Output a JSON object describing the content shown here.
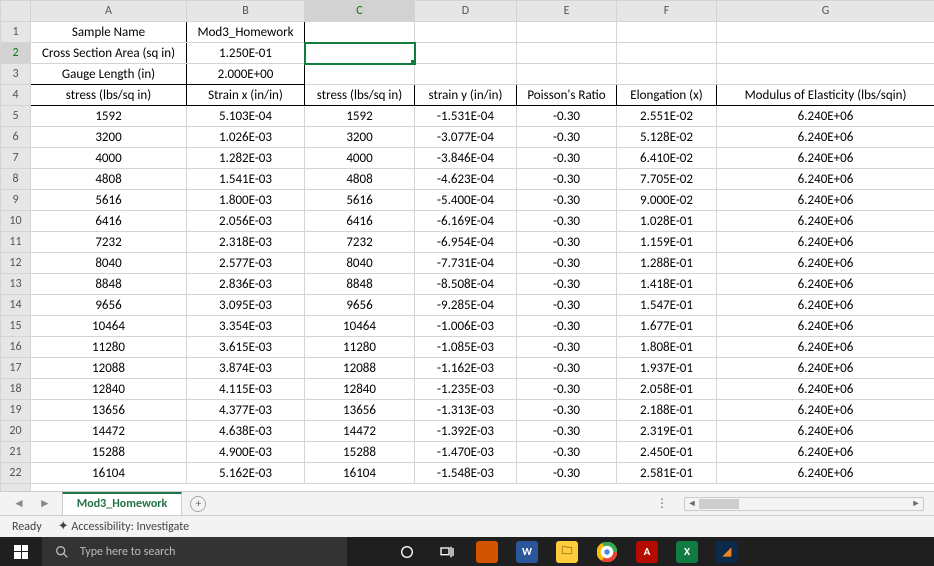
{
  "columns": [
    "A",
    "B",
    "C",
    "D",
    "E",
    "F",
    "G"
  ],
  "rowCount": 23,
  "selectedCell": "C2",
  "header": {
    "r1": {
      "A": "Sample Name",
      "B": "Mod3_Homework"
    },
    "r2": {
      "A": "Cross Section Area (sq in)",
      "B": "1.250E-01"
    },
    "r3": {
      "A": "Gauge Length (in)",
      "B": "2.000E+00"
    },
    "r4": {
      "A": "stress (lbs/sq in)",
      "B": "Strain x (in/in)",
      "C": "stress (lbs/sq in)",
      "D": "strain y (in/in)",
      "E": "Poisson's Ratio",
      "F": "Elongation (x)",
      "G": "Modulus of Elasticity (lbs/sqin)"
    }
  },
  "data": [
    {
      "A": "1592",
      "B": "5.103E-04",
      "C": "1592",
      "D": "-1.531E-04",
      "E": "-0.30",
      "F": "2.551E-02",
      "G": "6.240E+06"
    },
    {
      "A": "3200",
      "B": "1.026E-03",
      "C": "3200",
      "D": "-3.077E-04",
      "E": "-0.30",
      "F": "5.128E-02",
      "G": "6.240E+06"
    },
    {
      "A": "4000",
      "B": "1.282E-03",
      "C": "4000",
      "D": "-3.846E-04",
      "E": "-0.30",
      "F": "6.410E-02",
      "G": "6.240E+06"
    },
    {
      "A": "4808",
      "B": "1.541E-03",
      "C": "4808",
      "D": "-4.623E-04",
      "E": "-0.30",
      "F": "7.705E-02",
      "G": "6.240E+06"
    },
    {
      "A": "5616",
      "B": "1.800E-03",
      "C": "5616",
      "D": "-5.400E-04",
      "E": "-0.30",
      "F": "9.000E-02",
      "G": "6.240E+06"
    },
    {
      "A": "6416",
      "B": "2.056E-03",
      "C": "6416",
      "D": "-6.169E-04",
      "E": "-0.30",
      "F": "1.028E-01",
      "G": "6.240E+06"
    },
    {
      "A": "7232",
      "B": "2.318E-03",
      "C": "7232",
      "D": "-6.954E-04",
      "E": "-0.30",
      "F": "1.159E-01",
      "G": "6.240E+06"
    },
    {
      "A": "8040",
      "B": "2.577E-03",
      "C": "8040",
      "D": "-7.731E-04",
      "E": "-0.30",
      "F": "1.288E-01",
      "G": "6.240E+06"
    },
    {
      "A": "8848",
      "B": "2.836E-03",
      "C": "8848",
      "D": "-8.508E-04",
      "E": "-0.30",
      "F": "1.418E-01",
      "G": "6.240E+06"
    },
    {
      "A": "9656",
      "B": "3.095E-03",
      "C": "9656",
      "D": "-9.285E-04",
      "E": "-0.30",
      "F": "1.547E-01",
      "G": "6.240E+06"
    },
    {
      "A": "10464",
      "B": "3.354E-03",
      "C": "10464",
      "D": "-1.006E-03",
      "E": "-0.30",
      "F": "1.677E-01",
      "G": "6.240E+06"
    },
    {
      "A": "11280",
      "B": "3.615E-03",
      "C": "11280",
      "D": "-1.085E-03",
      "E": "-0.30",
      "F": "1.808E-01",
      "G": "6.240E+06"
    },
    {
      "A": "12088",
      "B": "3.874E-03",
      "C": "12088",
      "D": "-1.162E-03",
      "E": "-0.30",
      "F": "1.937E-01",
      "G": "6.240E+06"
    },
    {
      "A": "12840",
      "B": "4.115E-03",
      "C": "12840",
      "D": "-1.235E-03",
      "E": "-0.30",
      "F": "2.058E-01",
      "G": "6.240E+06"
    },
    {
      "A": "13656",
      "B": "4.377E-03",
      "C": "13656",
      "D": "-1.313E-03",
      "E": "-0.30",
      "F": "2.188E-01",
      "G": "6.240E+06"
    },
    {
      "A": "14472",
      "B": "4.638E-03",
      "C": "14472",
      "D": "-1.392E-03",
      "E": "-0.30",
      "F": "2.319E-01",
      "G": "6.240E+06"
    },
    {
      "A": "15288",
      "B": "4.900E-03",
      "C": "15288",
      "D": "-1.470E-03",
      "E": "-0.30",
      "F": "2.450E-01",
      "G": "6.240E+06"
    },
    {
      "A": "16104",
      "B": "5.162E-03",
      "C": "16104",
      "D": "-1.548E-03",
      "E": "-0.30",
      "F": "2.581E-01",
      "G": "6.240E+06"
    }
  ],
  "tabstrip": {
    "activeTab": "Mod3_Homework",
    "addLabel": "+"
  },
  "statusbar": {
    "ready": "Ready",
    "accessibility": "Accessibility: Investigate"
  },
  "taskbar": {
    "searchPlaceholder": "Type here to search"
  }
}
